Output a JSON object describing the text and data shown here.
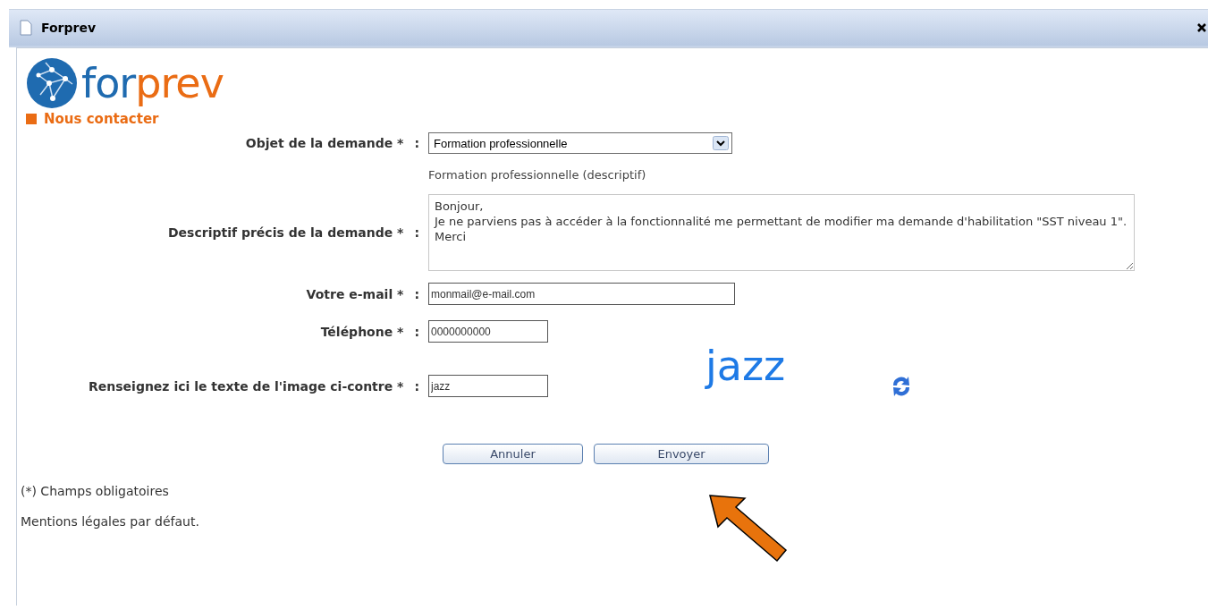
{
  "window": {
    "title": "Forprev"
  },
  "logo": {
    "part_1": "for",
    "part_2": "prev"
  },
  "section_title": "Nous contacter",
  "form": {
    "subject": {
      "label": "Objet de la demande *",
      "separator": ":",
      "value": "Formation professionnelle",
      "hint": "Formation professionnelle (descriptif)"
    },
    "description": {
      "label": "Descriptif précis de la demande *",
      "separator": ":",
      "value": "Bonjour,\nJe ne parviens pas à accéder à la fonctionnalité me permettant de modifier ma demande d'habilitation \"SST niveau 1\".\nMerci"
    },
    "email": {
      "label": "Votre e-mail *",
      "separator": ":",
      "value": "monmail@e-mail.com"
    },
    "phone": {
      "label": "Téléphone *",
      "separator": ":",
      "value": "0000000000"
    },
    "captcha": {
      "label": "Renseignez ici le texte de l'image ci-contre *",
      "separator": ":",
      "value": "jazz",
      "image_text": "jazz"
    }
  },
  "buttons": [
    {
      "label": "Annuler"
    },
    {
      "label": "Envoyer"
    }
  ],
  "footnotes": [
    "(*) Champs obligatoires",
    "Mentions légales par défaut."
  ]
}
